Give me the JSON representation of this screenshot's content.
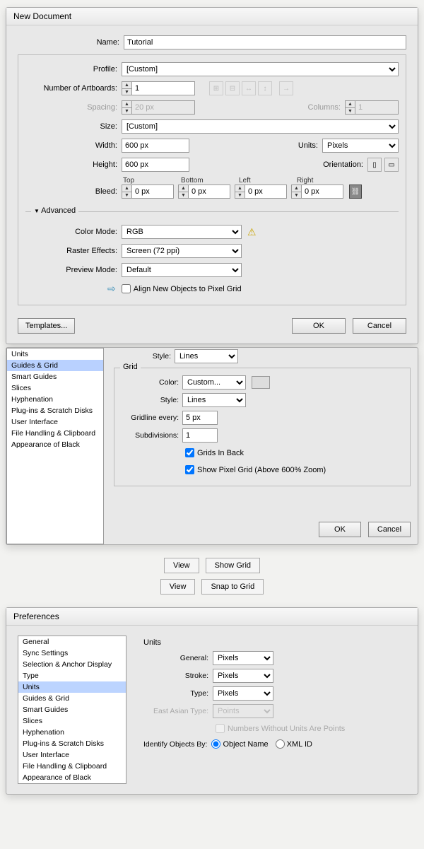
{
  "newdoc": {
    "title": "New Document",
    "nameLabel": "Name:",
    "nameValue": "Tutorial",
    "profileLabel": "Profile:",
    "profileValue": "[Custom]",
    "artboardsLabel": "Number of Artboards:",
    "artboardsValue": "1",
    "spacingLabel": "Spacing:",
    "spacingValue": "20 px",
    "columnsLabel": "Columns:",
    "columnsValue": "1",
    "sizeLabel": "Size:",
    "sizeValue": "[Custom]",
    "widthLabel": "Width:",
    "widthValue": "600 px",
    "unitsLabel": "Units:",
    "unitsValue": "Pixels",
    "heightLabel": "Height:",
    "heightValue": "600 px",
    "orientationLabel": "Orientation:",
    "bleedLabel": "Bleed:",
    "bleed": {
      "top": "Top",
      "bottom": "Bottom",
      "left": "Left",
      "right": "Right",
      "topV": "0 px",
      "bottomV": "0 px",
      "leftV": "0 px",
      "rightV": "0 px"
    },
    "advanced": "Advanced",
    "colorModeLabel": "Color Mode:",
    "colorModeValue": "RGB",
    "rasterLabel": "Raster Effects:",
    "rasterValue": "Screen (72 ppi)",
    "previewLabel": "Preview Mode:",
    "previewValue": "Default",
    "alignLabel": "Align New Objects to Pixel Grid",
    "templatesBtn": "Templates...",
    "okBtn": "OK",
    "cancelBtn": "Cancel"
  },
  "pref2": {
    "sidebar": [
      "Units",
      "Guides & Grid",
      "Smart Guides",
      "Slices",
      "Hyphenation",
      "Plug-ins & Scratch Disks",
      "User Interface",
      "File Handling & Clipboard",
      "Appearance of Black"
    ],
    "styleLabel": "Style:",
    "styleValue": "Lines",
    "gridLegend": "Grid",
    "colorLabel": "Color:",
    "colorValue": "Custom...",
    "style2Value": "Lines",
    "gridlineLabel": "Gridline every:",
    "gridlineValue": "5 px",
    "subdivLabel": "Subdivisions:",
    "subdivValue": "1",
    "gridsBack": "Grids In Back",
    "showPixel": "Show Pixel Grid (Above 600% Zoom)",
    "ok": "OK",
    "cancel": "Cancel"
  },
  "mid": {
    "view": "View",
    "showGrid": "Show Grid",
    "snapGrid": "Snap to Grid"
  },
  "pref3": {
    "title": "Preferences",
    "sidebar": [
      "General",
      "Sync Settings",
      "Selection & Anchor Display",
      "Type",
      "Units",
      "Guides & Grid",
      "Smart Guides",
      "Slices",
      "Hyphenation",
      "Plug-ins & Scratch Disks",
      "User Interface",
      "File Handling & Clipboard",
      "Appearance of Black"
    ],
    "unitsHeading": "Units",
    "generalLabel": "General:",
    "generalValue": "Pixels",
    "strokeLabel": "Stroke:",
    "strokeValue": "Pixels",
    "typeLabel": "Type:",
    "typeValue": "Pixels",
    "eastAsianLabel": "East Asian Type:",
    "eastAsianValue": "Points",
    "nwup": "Numbers Without Units Are Points",
    "identifyLabel": "Identify Objects By:",
    "objName": "Object Name",
    "xmlId": "XML ID"
  }
}
